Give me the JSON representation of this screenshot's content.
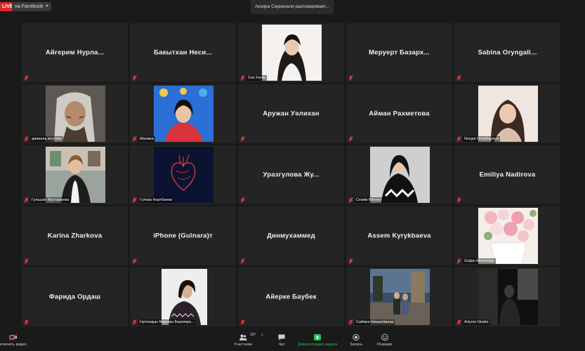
{
  "topbar": {
    "live_label": "LIVE",
    "facebook_label": "на Facebook",
    "speaking_banner": "Акзира Серикхали разговаривает..."
  },
  "tiles": {
    "r1c1": "Айгерим Нурла...",
    "r1c2": "Бакытхан Неси...",
    "r1c3": "Сех Fалія",
    "r1c4": "Меруерт Базарх...",
    "r1c5": "Sabina Oryngali...",
    "r2c1": "даниаль жгуткин",
    "r2c2": "Малика",
    "r2c3": "Аружан Уәлихан",
    "r2c4": "Айман Рахметова",
    "r2c5": "Nurgul Omyrbayeva",
    "r3c1": "Гульшат Мустапаева",
    "r3c2": "Гулназ Нартбаева",
    "r3c3": "Уразгулова Жу...",
    "r3c4": "Сезим Өтеген",
    "r3c5": "Emiliya Nadirova",
    "r4c1": "Karina Zharkova",
    "r4c2": "iPhone (Gulnara)т",
    "r4c3": "Динмухаммед",
    "r4c4": "Assem Kyrykbaeva",
    "r4c5": "Guljan Muhamjan",
    "r5c1": "Фарида Ордаш",
    "r5c2": "Нусіпақын Маржан Бақтиярк...",
    "r5c3": "Айерке Баубек",
    "r5c4": "Сайяра Нишанбаева",
    "r5c5": "Artyom Nosko"
  },
  "toolbar": {
    "video_label": "ключить видео",
    "participants_label": "Участники",
    "participants_count": "157",
    "chat_label": "Чат",
    "share_label": "Демонстрация экрана",
    "record_label": "Запись",
    "reactions_label": "Реакции"
  },
  "colors": {
    "background": "#1a1a1a",
    "tile": "#242424",
    "live_red": "#e02828",
    "share_green": "#25c25a",
    "muted_mic_red": "#e23b3b"
  },
  "icons": [
    "muted-mic-icon",
    "chevron-down-icon",
    "video-off-icon",
    "participants-icon",
    "chat-icon",
    "share-screen-icon",
    "record-icon",
    "reactions-icon"
  ]
}
